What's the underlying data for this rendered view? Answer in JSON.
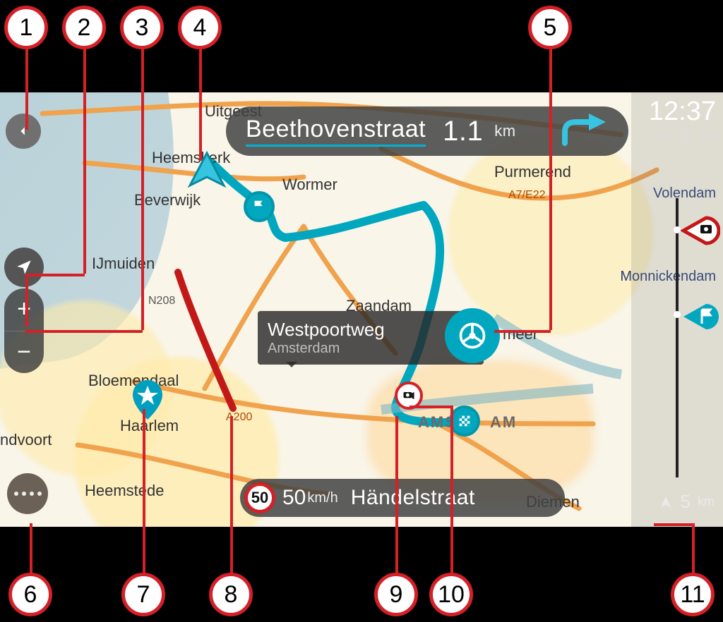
{
  "instruction": {
    "street": "Beethovenstraat",
    "distance": "1.1",
    "unit": "km"
  },
  "arrival": {
    "time": "12:37",
    "remaining_value": "32",
    "remaining_unit": "km"
  },
  "speed": {
    "limit": "50",
    "current": "50",
    "unit": "km/h",
    "current_street": "Händelstraat"
  },
  "selected_location": {
    "name": "Westpoortweg",
    "city": "Amsterdam"
  },
  "routebar": {
    "scale_value": "5",
    "scale_unit": "km"
  },
  "roads": {
    "n208": "N208",
    "a200": "A200",
    "a7e22": "A7/E22"
  },
  "cities": {
    "uitgeest": "Uitgeest",
    "heemskerk": "Heemskerk",
    "beverwijk": "Beverwijk",
    "ijmuiden": "IJmuiden",
    "bloemendaal": "Bloemendaal",
    "haarlem": "Haarlem",
    "heemstede": "Heemstede",
    "ndvoort": "ndvoort",
    "wormer": "Wormer",
    "zaandam": "Zaandam",
    "purmerend": "Purmerend",
    "volendam": "Volendam",
    "monnickendam": "Monnickendam",
    "amsterdam_prefix": "AMS",
    "amsterdam_suffix": "AM",
    "diemen": "Diemen",
    "meer": "meer"
  },
  "callouts": {
    "1": "1",
    "2": "2",
    "3": "3",
    "4": "4",
    "5": "5",
    "6": "6",
    "7": "7",
    "8": "8",
    "9": "9",
    "10": "10",
    "11": "11"
  },
  "glyphs": {
    "plus": "+",
    "minus": "−"
  }
}
